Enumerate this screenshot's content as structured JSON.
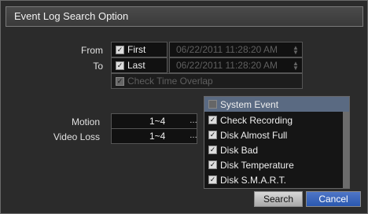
{
  "dialog": {
    "title": "Event Log Search Option",
    "from": {
      "label": "From",
      "option": "First",
      "datetime": "06/22/2011  11:28:20 AM"
    },
    "to": {
      "label": "To",
      "option": "Last",
      "datetime": "06/22/2011  11:28:20 AM"
    },
    "overlap": {
      "label": "Check Time Overlap"
    },
    "motion": {
      "label": "Motion",
      "value": "1~4"
    },
    "videoloss": {
      "label": "Video Loss",
      "value": "1~4"
    },
    "list": {
      "header": "System Event",
      "items": [
        "Check Recording",
        "Disk Almost Full",
        "Disk Bad",
        "Disk Temperature",
        "Disk S.M.A.R.T."
      ]
    },
    "buttons": {
      "search": "Search",
      "cancel": "Cancel"
    }
  }
}
